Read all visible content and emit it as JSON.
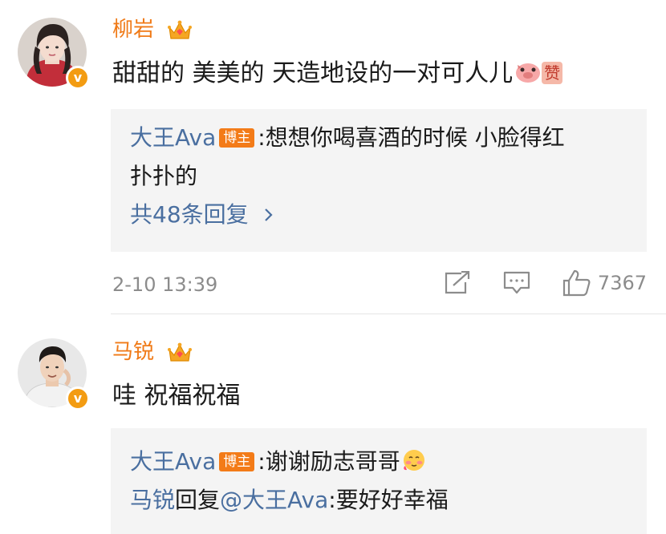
{
  "comments": [
    {
      "username": "柳岩",
      "content": "甜甜的 美美的 天造地设的一对可人儿",
      "sticker_label": "赞",
      "replies": [
        {
          "author": "大王Ava",
          "tag": "博主",
          "sep": ":",
          "text": "想想你喝喜酒的时候 小脸得红",
          "text2": "扑扑的"
        }
      ],
      "more_replies": "共48条回复",
      "time": "2-10 13:39",
      "likes": "7367"
    },
    {
      "username": "马锐",
      "content": "哇 祝福祝福",
      "replies": [
        {
          "author": "大王Ava",
          "tag": "博主",
          "sep": ":",
          "text": "谢谢励志哥哥"
        },
        {
          "author": "马锐",
          "verb": "回复",
          "mention": "@大王Ava",
          "sep": ":",
          "text": "要好好幸福"
        }
      ]
    }
  ],
  "icons": [
    "crown-icon",
    "verified-badge-icon",
    "share-icon",
    "comment-icon",
    "like-icon",
    "chevron-right-icon",
    "blush-emoji-icon"
  ],
  "colors": {
    "username": "#f07a17",
    "link": "#4a6fa0",
    "tag_bg": "#f37b18",
    "reply_bg": "#f4f4f4",
    "meta": "#8c8c8c"
  }
}
